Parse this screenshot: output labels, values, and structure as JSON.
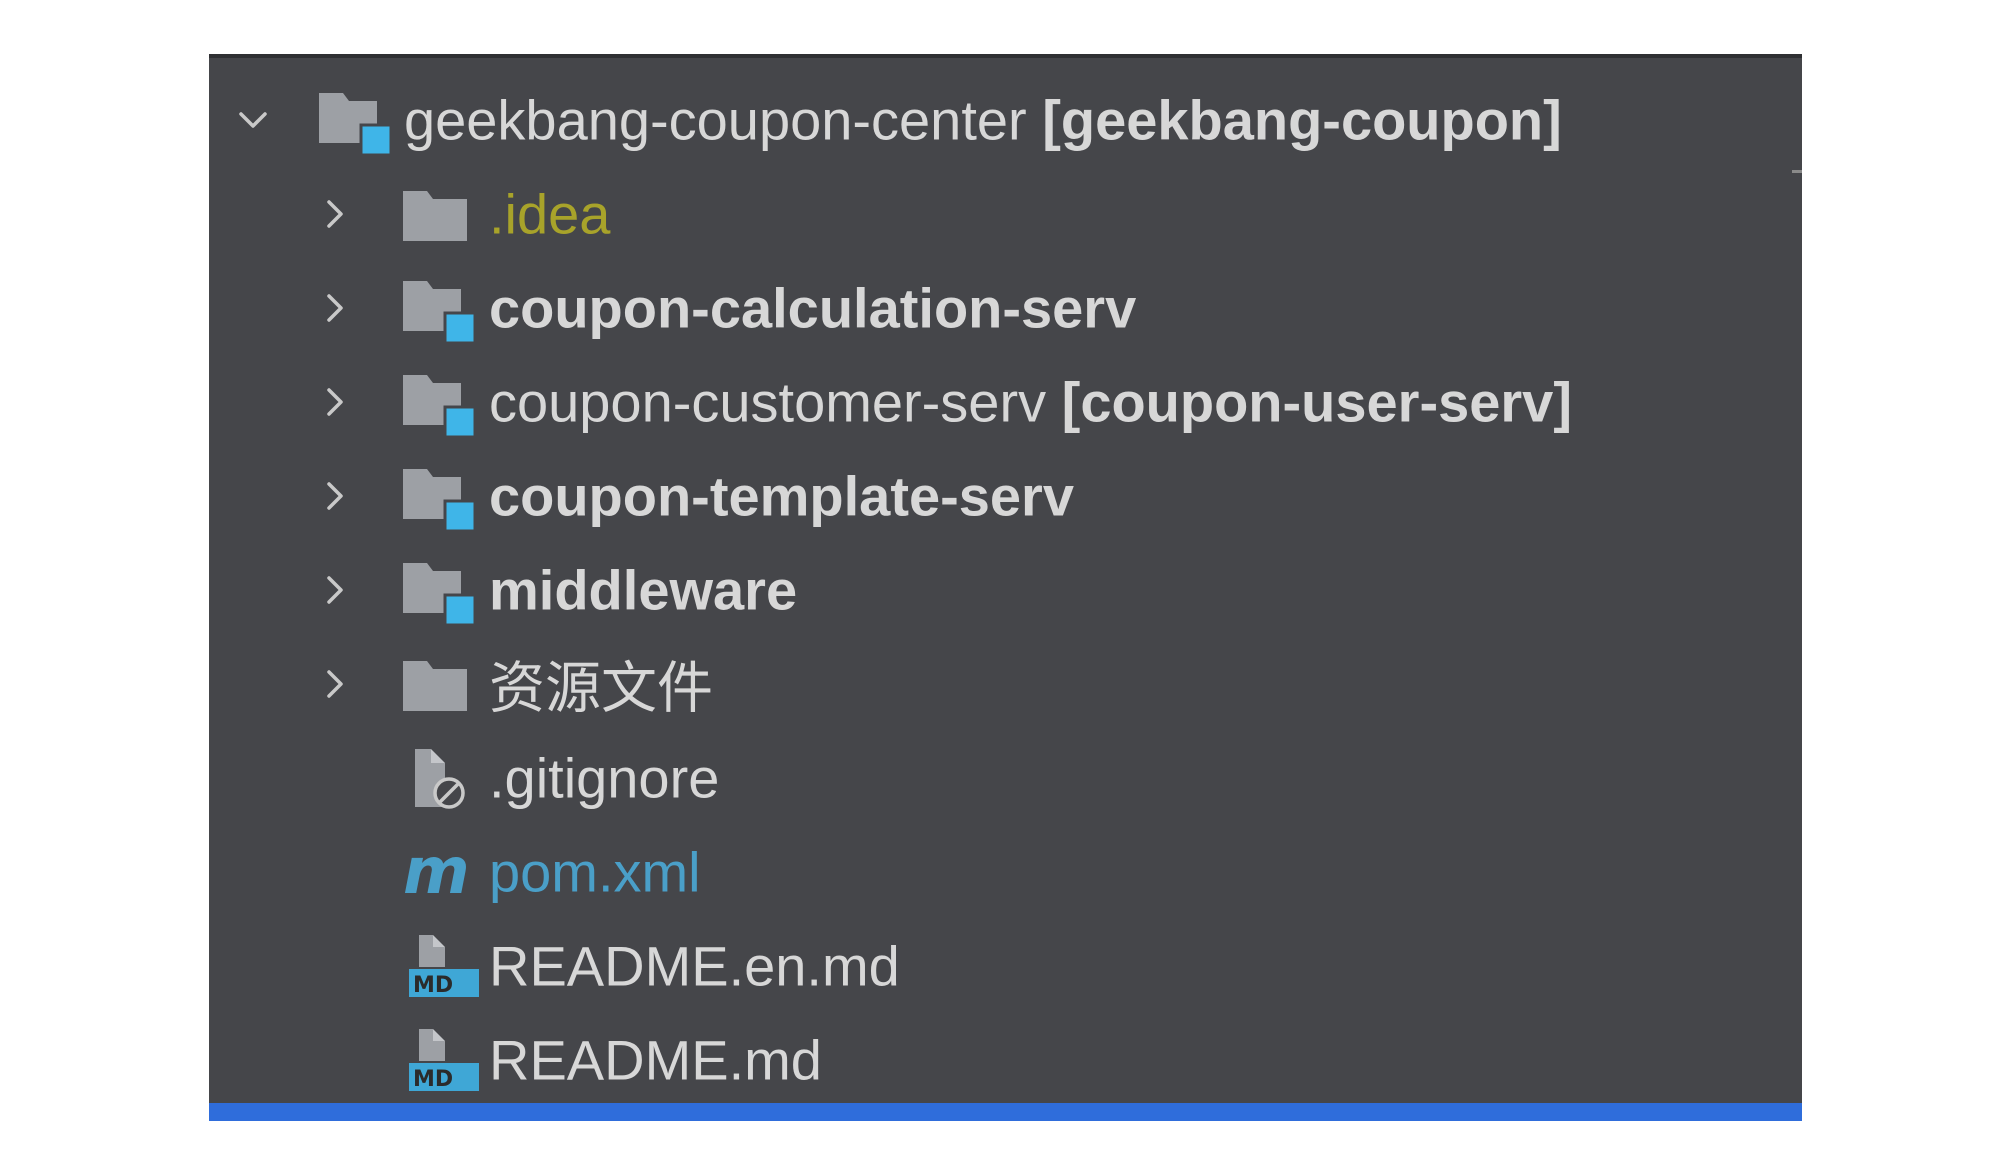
{
  "colors": {
    "panel_bg": "#45464a",
    "text": "#d7d7d7",
    "excluded_text": "#a8a32a",
    "maven_blue": "#4a9fc8",
    "folder_gray": "#9da0a5",
    "module_badge": "#3fb5e8",
    "selection_bar": "#2f6ddb"
  },
  "tree": {
    "root": {
      "name": "geekbang-coupon-center",
      "module_name": "[geekbang-coupon]",
      "icon": "module-folder-icon",
      "expanded": true
    },
    "children": [
      {
        "name": ".idea",
        "suffix": "",
        "icon": "folder-icon",
        "style": "excluded"
      },
      {
        "name": "coupon-calculation-serv",
        "suffix": "",
        "icon": "module-folder-icon",
        "style": "bold"
      },
      {
        "name": "coupon-customer-serv",
        "suffix": "[coupon-user-serv]",
        "icon": "module-folder-icon",
        "style": "normal"
      },
      {
        "name": "coupon-template-serv",
        "suffix": "",
        "icon": "module-folder-icon",
        "style": "bold"
      },
      {
        "name": "middleware",
        "suffix": "",
        "icon": "module-folder-icon",
        "style": "bold"
      },
      {
        "name": "资源文件",
        "suffix": "",
        "icon": "folder-icon",
        "style": "normal"
      }
    ],
    "files": [
      {
        "name": ".gitignore",
        "icon": "ignore-file-icon",
        "style": "normal"
      },
      {
        "name": "pom.xml",
        "icon": "maven-icon",
        "style": "maven"
      },
      {
        "name": "README.en.md",
        "icon": "markdown-file-icon",
        "style": "normal"
      },
      {
        "name": "README.md",
        "icon": "markdown-file-icon",
        "style": "normal"
      }
    ]
  },
  "icons": {
    "markdown_badge": "MD",
    "maven_glyph": "m"
  }
}
